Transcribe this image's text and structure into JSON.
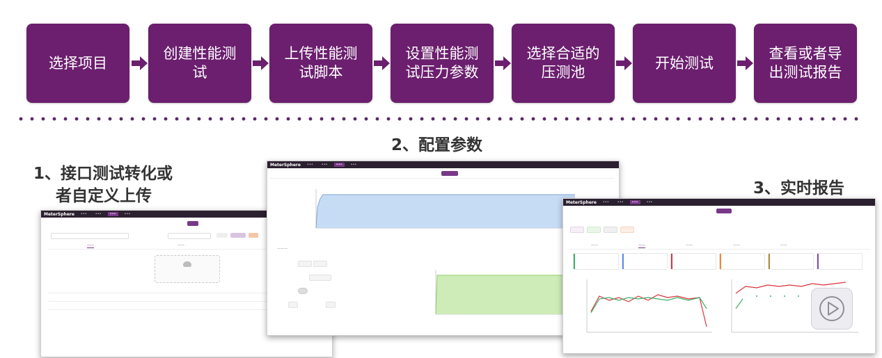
{
  "flow": {
    "steps": [
      {
        "line1": "选择项目",
        "line2": ""
      },
      {
        "line1": "创建性能测",
        "line2": "试"
      },
      {
        "line1": "上传性能测",
        "line2": "试脚本"
      },
      {
        "line1": "设置性能测",
        "line2": "试压力参数"
      },
      {
        "line1": "选择合适的",
        "line2": "压测池"
      },
      {
        "line1": "开始测试",
        "line2": ""
      },
      {
        "line1": "查看或者导",
        "line2": "出测试报告"
      }
    ],
    "step_color": "#6b1f6e",
    "arrow_color": "#6b1f6e"
  },
  "captions": {
    "one_line1": "1、接口测试转化或",
    "one_line2": "者自定义上传",
    "two": "2、配置参数",
    "three": "3、实时报告"
  },
  "brand": {
    "logo": "MeterSphere",
    "accent": "#783887"
  },
  "colors": {
    "blue_area": "#bcd6f2",
    "green_area": "#c9eab0",
    "red_line": "#d8323a",
    "green_line": "#3fae6a"
  }
}
